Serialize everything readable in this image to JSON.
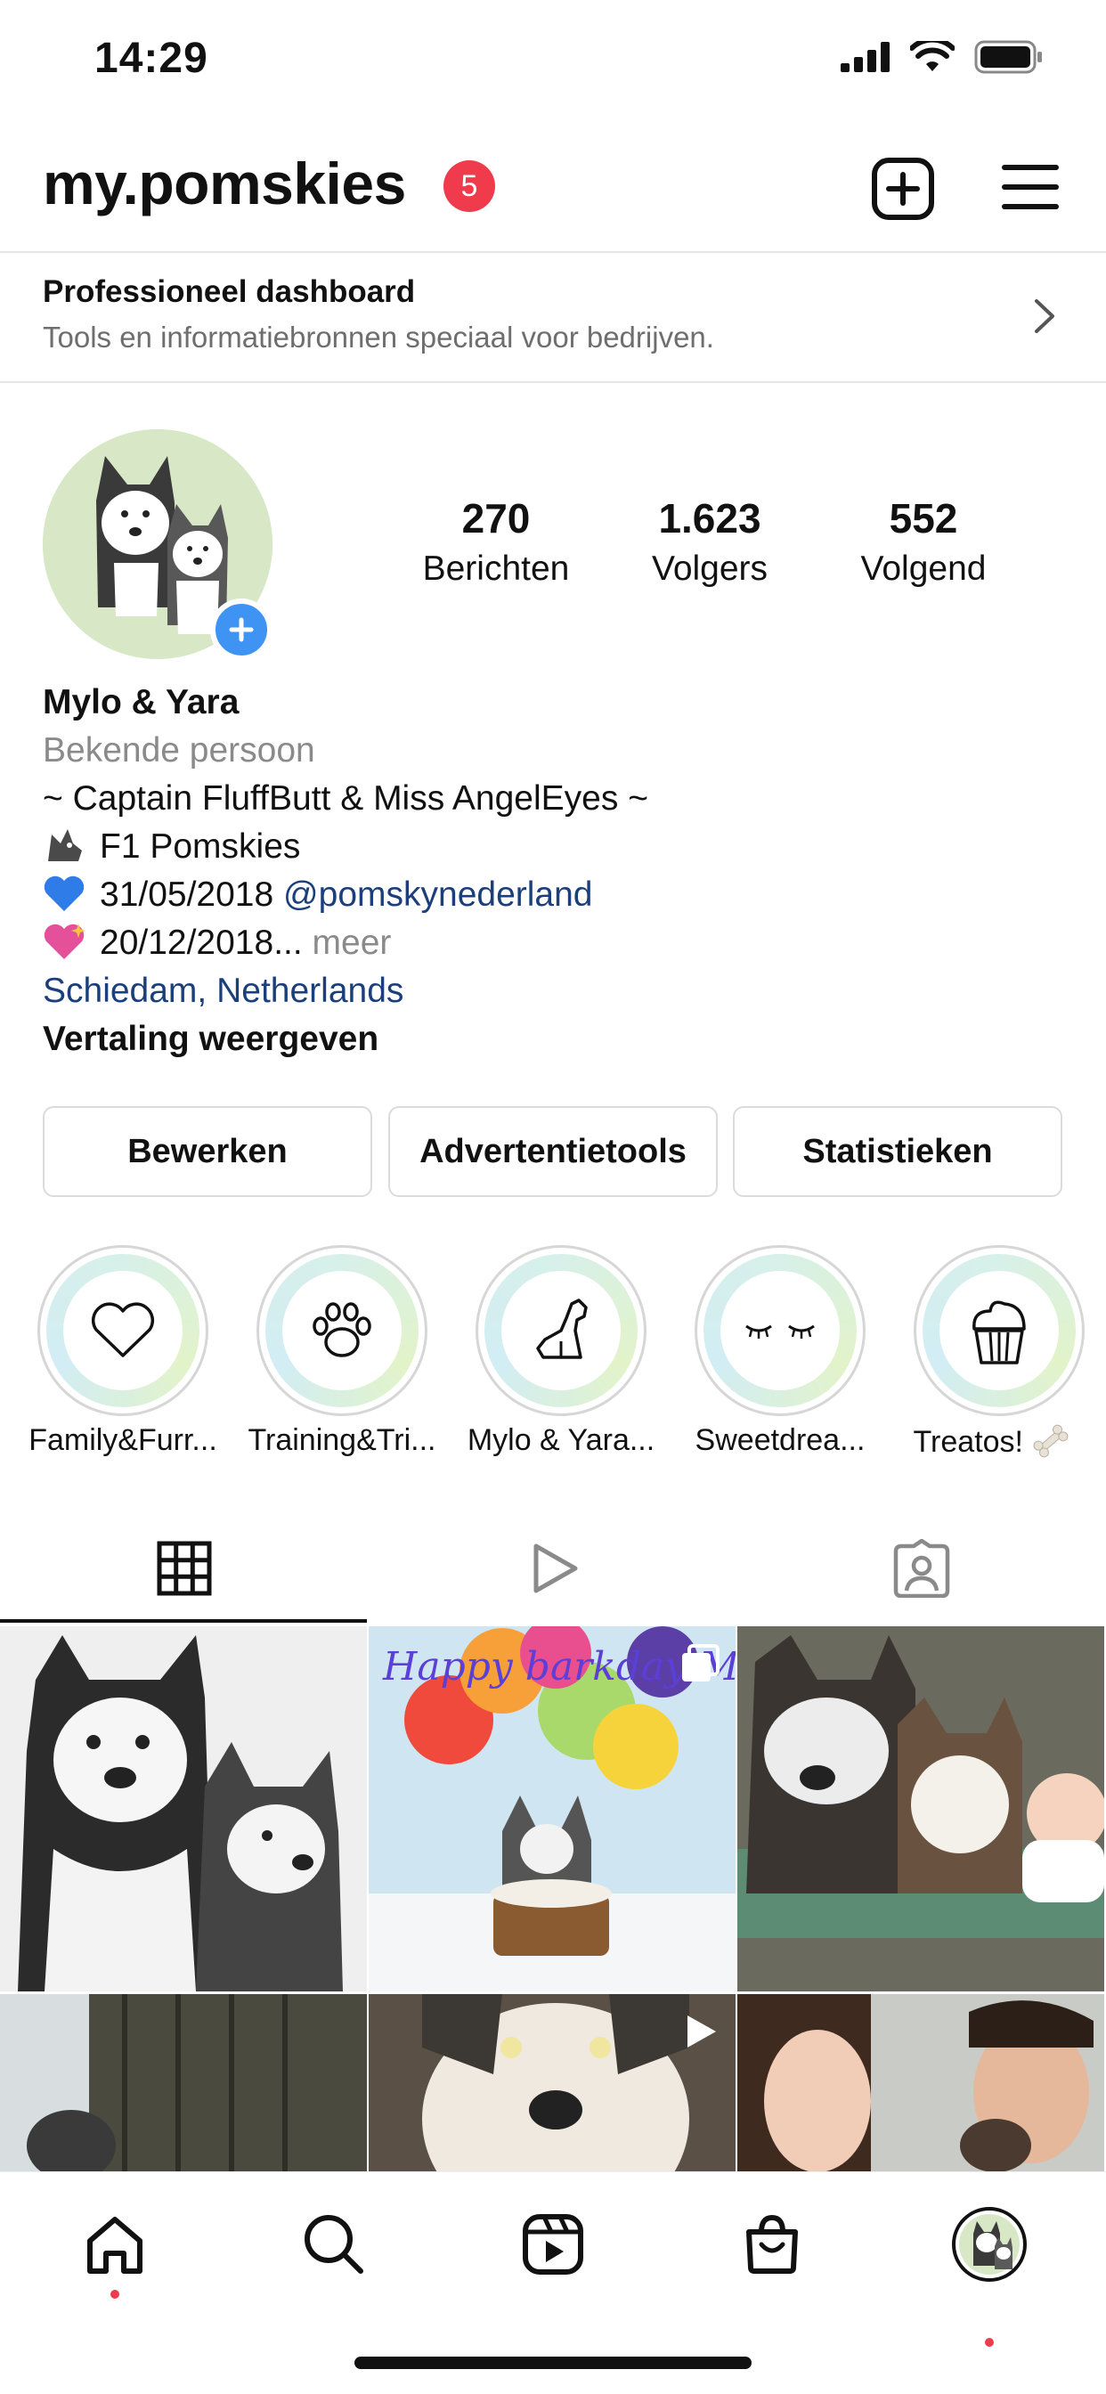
{
  "status_bar": {
    "time": "14:29"
  },
  "header": {
    "username": "my.pomskies",
    "notification_count": "5"
  },
  "dashboard": {
    "title": "Professioneel dashboard",
    "subtitle": "Tools en informatiebronnen speciaal voor bedrijven."
  },
  "stats": [
    {
      "value": "270",
      "label": "Berichten"
    },
    {
      "value": "1.623",
      "label": "Volgers"
    },
    {
      "value": "552",
      "label": "Volgend"
    }
  ],
  "bio": {
    "name": "Mylo & Yara",
    "category": "Bekende persoon",
    "line1": "~ Captain FluffButt & Miss AngelEyes ~",
    "line2": "F1 Pomskies",
    "line3_date": "31/05/2018",
    "line3_mention": "@pomskynederland",
    "line4_date": "20/12/2018...",
    "line4_more": "meer",
    "location": "Schiedam, Netherlands",
    "translate": "Vertaling weergeven"
  },
  "buttons": {
    "edit": "Bewerken",
    "ad_tools": "Advertentietools",
    "insights": "Statistieken"
  },
  "highlights": [
    {
      "label": "Family&Furr...",
      "icon": "heart-icon"
    },
    {
      "label": "Training&Tri...",
      "icon": "paw-icon"
    },
    {
      "label": "Mylo & Yara...",
      "icon": "dog-icon"
    },
    {
      "label": "Sweetdrea...",
      "icon": "eyelashes-icon"
    },
    {
      "label": "Treatos!",
      "icon": "cupcake-icon"
    }
  ],
  "grid_overlay_text": "Happy barkday My!",
  "colors": {
    "badge": "#ef3b4c",
    "link": "#1b3f7a",
    "plus_button": "#3e93f3"
  }
}
